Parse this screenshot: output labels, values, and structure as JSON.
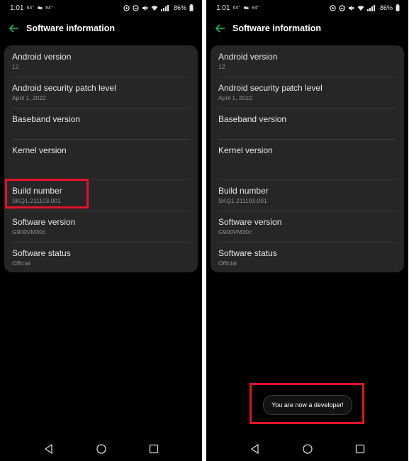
{
  "screens": [
    {
      "status": {
        "time": "1:01",
        "temp1": "64°",
        "temp2": "84°",
        "battery": "86%"
      },
      "header": {
        "title": "Software information"
      },
      "items": [
        {
          "label": "Android version",
          "value": "12"
        },
        {
          "label": "Android security patch level",
          "value": "April 1, 2022"
        },
        {
          "label": "Baseband version",
          "value": ""
        },
        {
          "label": "Kernel version",
          "value": ""
        },
        {
          "label": "Build number",
          "value": "SKQ1.211103.001"
        },
        {
          "label": "Software version",
          "value": "G900VM30c"
        },
        {
          "label": "Software status",
          "value": "Official"
        }
      ],
      "highlighted_item": "Build number"
    },
    {
      "status": {
        "time": "1:01",
        "temp1": "64°",
        "temp2": "84°",
        "battery": "86%"
      },
      "header": {
        "title": "Software information"
      },
      "items": [
        {
          "label": "Android version",
          "value": "12"
        },
        {
          "label": "Android security patch level",
          "value": "April 1, 2022"
        },
        {
          "label": "Baseband version",
          "value": ""
        },
        {
          "label": "Kernel version",
          "value": ""
        },
        {
          "label": "Build number",
          "value": "SKQ1.211103.001"
        },
        {
          "label": "Software version",
          "value": "G900VM30c"
        },
        {
          "label": "Software status",
          "value": "Official"
        }
      ],
      "toast": "You are now a developer!"
    }
  ],
  "colors": {
    "background": "#000000",
    "card": "#262626",
    "accent_green": "#1db954",
    "highlight_red": "#e3132a",
    "secondary_text": "#8f8f8f"
  },
  "icons": {
    "back": "arrow-left-icon",
    "nav": [
      "back-triangle-icon",
      "home-circle-icon",
      "recents-square-icon"
    ]
  }
}
